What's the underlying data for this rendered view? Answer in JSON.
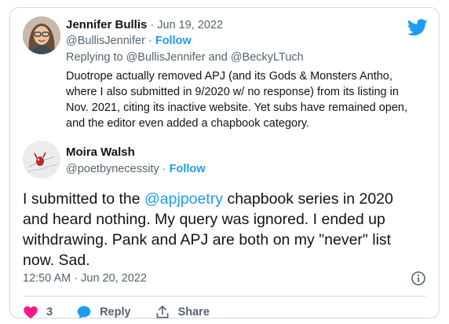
{
  "reply_tweet": {
    "author_name": "Jennifer Bullis",
    "date": "Jun 19, 2022",
    "separator": "·",
    "handle": "@BullisJennifer",
    "follow_label": "Follow",
    "replying_prefix": "Replying to",
    "replying_user1": "@BullisJennifer",
    "replying_and": "and",
    "replying_user2": "@BeckyLTuch",
    "text_line1": "Duotrope actually removed APJ (and its Gods & Monsters Antho,",
    "text_line2": "where I also submitted in 9/2020 w/ no response) from its listing in",
    "text_line3": "Nov. 2021, citing its inactive website. Yet subs have remained open,",
    "text_line4": "and the editor even added a chapbook category."
  },
  "main_tweet": {
    "author_name": "Moira Walsh",
    "handle": "@poetbynecessity",
    "separator": "·",
    "follow_label": "Follow",
    "text_before_mention": "I submitted to the",
    "mention": "@apjpoetry",
    "text_line1_after": "chapbook series in 2020",
    "text_line2": "and heard nothing. My query was ignored. I ended up",
    "text_line3": "withdrawing. Pank and APJ are both on my \"never\" list",
    "text_line4": "now. Sad.",
    "timestamp": "12:50 AM · Jun 20, 2022",
    "like_count": "3",
    "reply_label": "Reply",
    "share_label": "Share"
  },
  "colors": {
    "brand_blue": "#1d9bf0",
    "like_red": "#f91880",
    "text": "#0f1419",
    "muted": "#536471",
    "border": "#cfd9de"
  },
  "icons": [
    "twitter-bird-icon",
    "heart-icon",
    "reply-bubble-icon",
    "share-icon",
    "info-icon"
  ]
}
